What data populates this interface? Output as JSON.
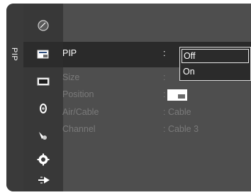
{
  "sidebar": {
    "tab_label": "PIP"
  },
  "icons": [
    {
      "name": "picture-icon"
    },
    {
      "name": "pip-icon"
    },
    {
      "name": "screen-icon"
    },
    {
      "name": "sound-icon"
    },
    {
      "name": "channel-icon"
    },
    {
      "name": "setup-icon"
    },
    {
      "name": "input-icon"
    }
  ],
  "menu": {
    "pip": {
      "label": "PIP",
      "separator": ":"
    },
    "size": {
      "label": "Size",
      "separator": ":"
    },
    "position": {
      "label": "Position",
      "separator": ":"
    },
    "air_cable": {
      "label": "Air/Cable",
      "value": ": Cable"
    },
    "channel": {
      "label": "Channel",
      "value": ": Cable 3"
    }
  },
  "dropdown": {
    "options": [
      "Off",
      "On"
    ],
    "selected": "Off"
  },
  "colors": {
    "panel": "#4e4e4e",
    "highlight": "#2a2a2a",
    "active_text": "#ffffff",
    "dim_text": "#7a7a7a"
  }
}
